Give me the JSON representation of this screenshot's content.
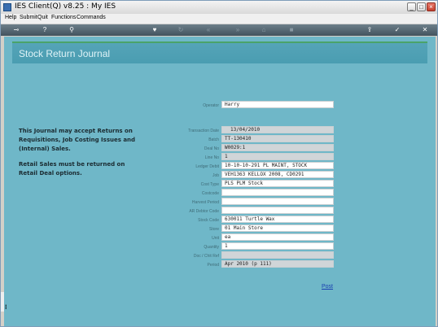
{
  "window": {
    "title": "IES Client(Q) v8.25 : My IES",
    "controls": [
      "_",
      "□",
      "×"
    ]
  },
  "menu": [
    "Help",
    "Submit",
    "Quit",
    "Functions",
    "Commands"
  ],
  "toolbar": {
    "icons": [
      "key-icon",
      "help-icon",
      "search-icon",
      "heart-icon",
      "refresh-icon",
      "rewind-icon",
      "fast-forward-icon",
      "trash-icon",
      "stop-icon",
      "upload-icon",
      "check-icon",
      "close-icon"
    ]
  },
  "header": {
    "title": "Stock Return Journal"
  },
  "info": {
    "para1": "This Journal may accept Returns on Requisitions, Job Costing Issues and (Internal) Sales.",
    "para2": "Retail Sales must be returned on Retail Deal options."
  },
  "form": {
    "operator_label": "Operator",
    "operator_value": "Harry",
    "fields": [
      {
        "label": "Transaction Date",
        "value": "13/04/2010"
      },
      {
        "label": "Batch",
        "value": "TT-130410"
      },
      {
        "label": "Deal No",
        "value": "W0029:1"
      },
      {
        "label": "Line No",
        "value": "1"
      },
      {
        "label": "Ledger Debit",
        "value": "10-10-10-291 PL MAINT, STOCK"
      },
      {
        "label": "Job",
        "value": "VEH1363 KELLOX 2008, CD0291"
      },
      {
        "label": "Cost Type",
        "value": "PLS PLM Stock"
      },
      {
        "label": "Costcode",
        "value": ""
      },
      {
        "label": "Harvest Period",
        "value": ""
      },
      {
        "label": "AR Debtor Code",
        "value": ""
      },
      {
        "label": "Stock Code",
        "value": "630011 Turtle Wax"
      },
      {
        "label": "Store",
        "value": "01 Main Store"
      },
      {
        "label": "Unit",
        "value": "ea"
      },
      {
        "label": "Quantity",
        "value": "1"
      },
      {
        "label": "Doc / Chit Ref",
        "value": ""
      },
      {
        "label": "Period",
        "value": "Apr 2010 (p 111)"
      }
    ]
  },
  "actions": {
    "post": "Post"
  },
  "colors": {
    "content_bg": "#6fb7c8",
    "header_band": "#4a9db1",
    "toolbar": "#4a5b66"
  }
}
